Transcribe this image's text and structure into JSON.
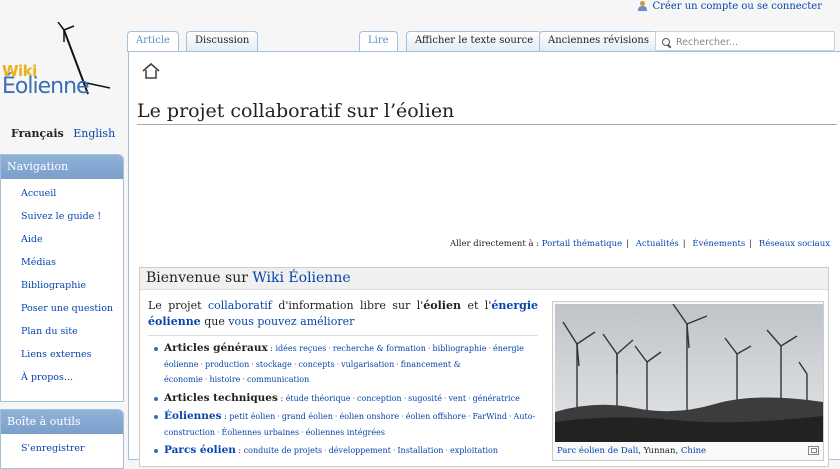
{
  "personal": {
    "create_account": "Créer un compte ou se connecter"
  },
  "logo": {
    "line1": "Wiki",
    "line2": "Éolienne"
  },
  "languages": {
    "current": "Français",
    "other": "English"
  },
  "navigation": {
    "title": "Navigation",
    "items": [
      "Accueil",
      "Suivez le guide !",
      "Aide",
      "Médias",
      "Bibliographie",
      "Poser une question",
      "Plan du site",
      "Liens externes",
      "À propos..."
    ]
  },
  "tools": {
    "title": "Boîte à outils",
    "items": [
      "S'enregistrer"
    ]
  },
  "tabs": {
    "article": "Article",
    "discussion": "Discussion",
    "read": "Lire",
    "view_source": "Afficher le texte source",
    "history": "Anciennes révisions"
  },
  "search": {
    "placeholder": "Rechercher..."
  },
  "page": {
    "title": "Le projet collaboratif sur l’éolien"
  },
  "jump": {
    "label": "Aller directement à :",
    "links": [
      "Portail thématique",
      "Actualités",
      "Événements",
      "Réseaux sociaux"
    ]
  },
  "welcome": {
    "prefix": "Bienvenue sur",
    "site": "Wiki Éolienne",
    "intro": {
      "t1": "Le projet",
      "l1": "collaboratif",
      "t2": "d'information libre sur l'",
      "b1": "éolien",
      "t3": "et l'",
      "l2": "énergie éolienne",
      "t4": "que",
      "l3": "vous pouvez améliorer"
    }
  },
  "sections": [
    {
      "label": "Articles généraux",
      "is_link": false,
      "links": [
        "idées reçues",
        "recherche & formation",
        "bibliographie",
        "énergie éolienne",
        "production",
        "stockage",
        "concepts",
        "vulgarisation",
        "financement & économie",
        "histoire",
        "communication"
      ]
    },
    {
      "label": "Articles techniques",
      "is_link": false,
      "links": [
        "étude théorique",
        "conception",
        "sugosité",
        "vent",
        "génératrice"
      ]
    },
    {
      "label": "Éoliennes",
      "is_link": true,
      "links": [
        "petit éolien",
        "grand éolien",
        "éolien onshore",
        "éolien offshore",
        "FarWind",
        "Auto-construction",
        "Éoliennes urbaines",
        "éoliennes intégrées"
      ]
    },
    {
      "label": "Parcs éolien",
      "is_link": true,
      "links": [
        "conduite de projets",
        "développement",
        "Installation",
        "exploitation"
      ]
    }
  ],
  "photo": {
    "caption_link": "Parc éolien de Dali",
    "caption_rest": ", Yunnan, ",
    "caption_link2": "Chine"
  },
  "colors": {
    "link": "#0645ad",
    "portlet_header": "#7a9fcb",
    "border": "#a7c0da"
  }
}
